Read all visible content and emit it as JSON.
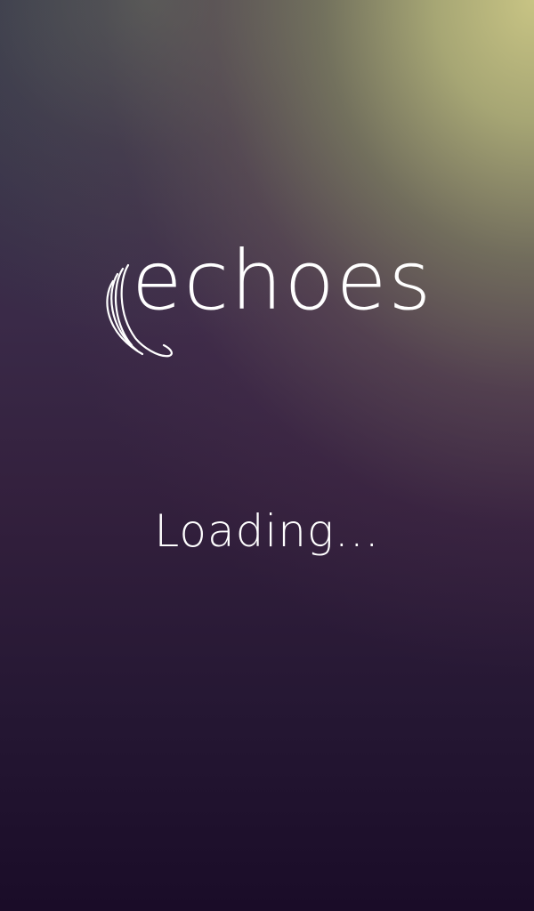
{
  "app": {
    "logo_text": "echoes",
    "logo_icon": "sound-waves-icon"
  },
  "status": {
    "loading_text": "Loading..."
  }
}
